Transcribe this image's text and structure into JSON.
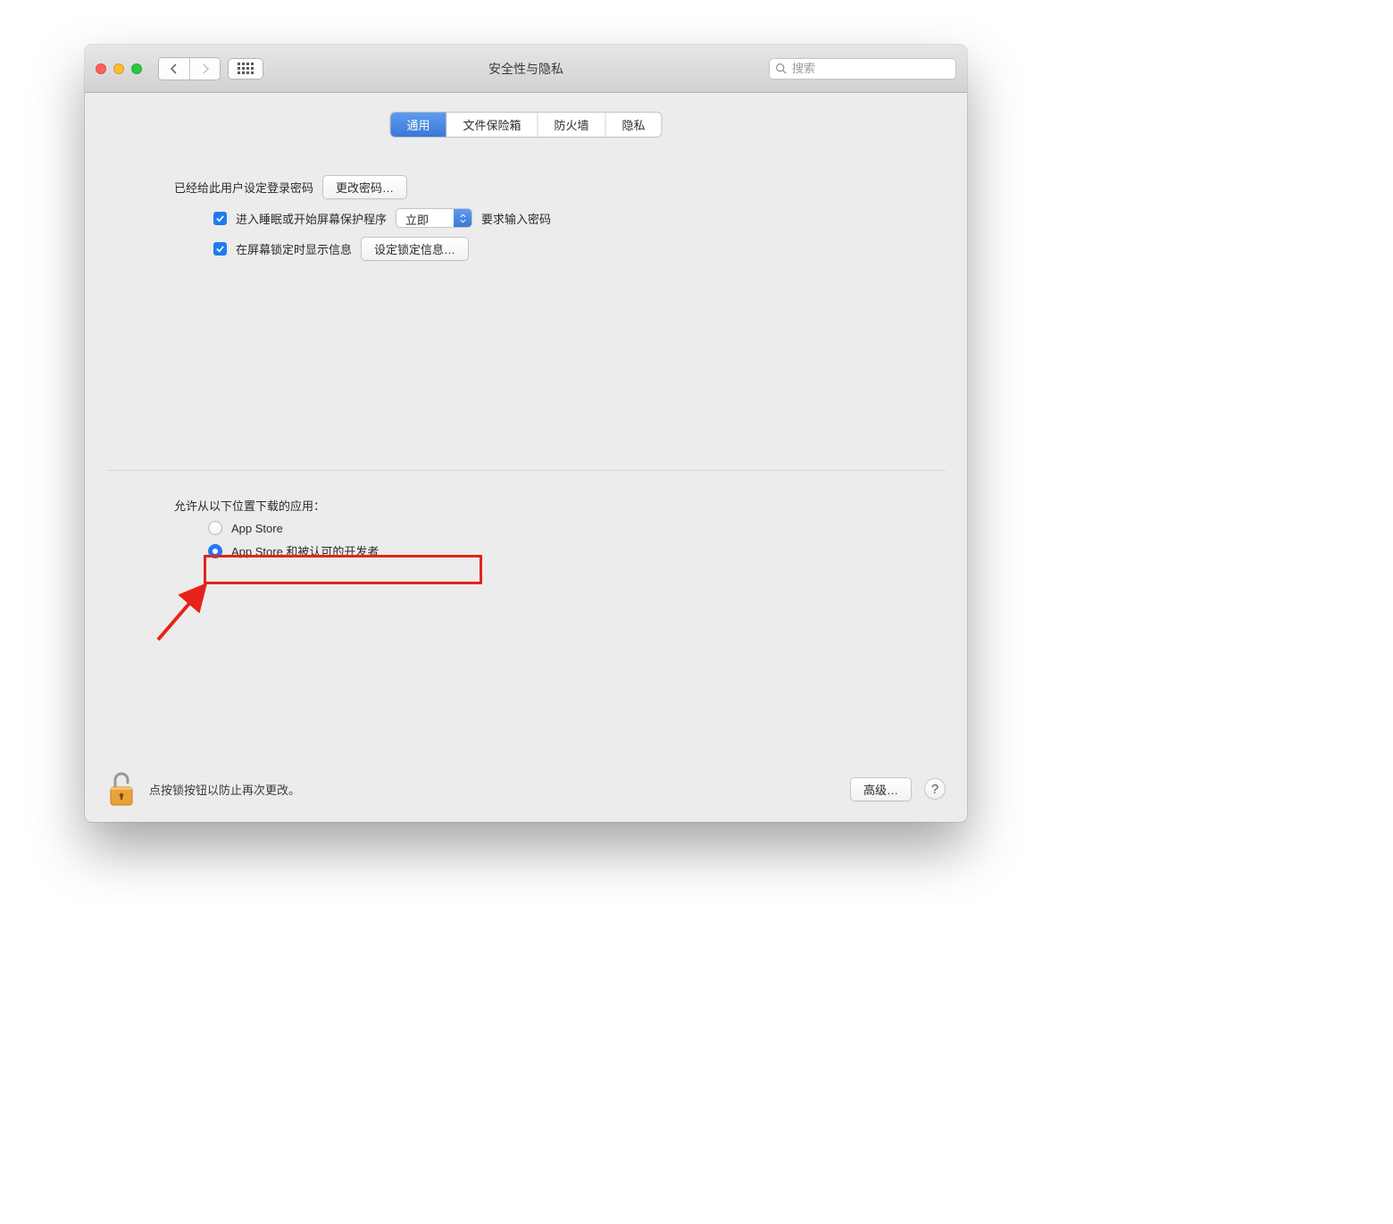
{
  "toolbar": {
    "title": "安全性与隐私",
    "search_placeholder": "搜索"
  },
  "tabs": {
    "general": "通用",
    "filevault": "文件保险箱",
    "firewall": "防火墙",
    "privacy": "隐私"
  },
  "general": {
    "login_password_set_label": "已经给此用户设定登录密码",
    "change_password_btn": "更改密码…",
    "require_password_checkbox_prefix": "进入睡眠或开始屏幕保护程序",
    "require_password_select_value": "立即",
    "require_password_suffix": "要求输入密码",
    "show_lock_message_checkbox": "在屏幕锁定时显示信息",
    "set_lock_message_btn": "设定锁定信息…"
  },
  "allow": {
    "heading": "允许从以下位置下载的应用：",
    "option_app_store": "App Store",
    "option_identified": "App Store 和被认可的开发者"
  },
  "footer": {
    "lock_hint": "点按锁按钮以防止再次更改。",
    "advanced_btn": "高级…",
    "help": "?"
  }
}
